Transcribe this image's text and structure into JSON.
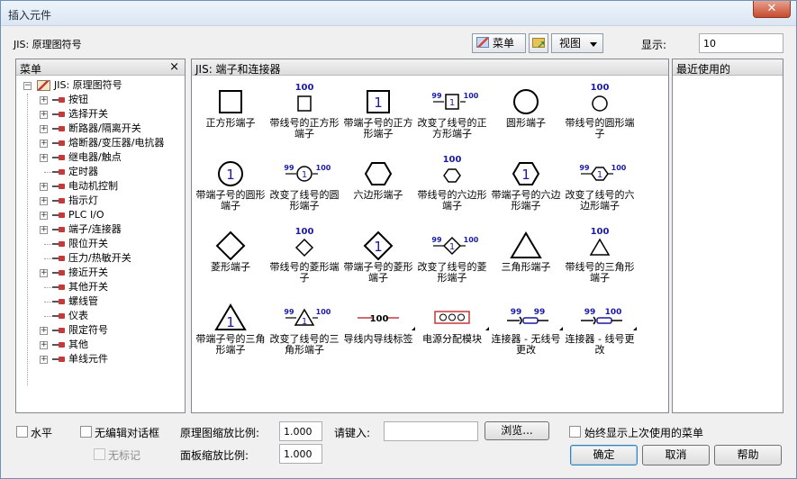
{
  "window": {
    "title": "插入元件"
  },
  "toolbar": {
    "path": "JIS: 原理图符号",
    "menu_btn": "菜单",
    "view_btn": "视图",
    "display_label": "显示:",
    "display_value": "10"
  },
  "left_panel": {
    "title": "菜单",
    "close": "×",
    "root": "JIS: 原理图符号",
    "items": [
      {
        "label": "按钮",
        "expander": "+"
      },
      {
        "label": "选择开关",
        "expander": "+"
      },
      {
        "label": "断路器/隔离开关",
        "expander": "+"
      },
      {
        "label": "熔断器/变压器/电抗器",
        "expander": "+"
      },
      {
        "label": "继电器/触点",
        "expander": "+"
      },
      {
        "label": "定时器",
        "expander": ""
      },
      {
        "label": "电动机控制",
        "expander": "+"
      },
      {
        "label": "指示灯",
        "expander": "+"
      },
      {
        "label": "PLC I/O",
        "expander": "+"
      },
      {
        "label": "端子/连接器",
        "expander": "+"
      },
      {
        "label": "限位开关",
        "expander": ""
      },
      {
        "label": "压力/热敏开关",
        "expander": ""
      },
      {
        "label": "接近开关",
        "expander": "+"
      },
      {
        "label": "其他开关",
        "expander": ""
      },
      {
        "label": "螺线管",
        "expander": ""
      },
      {
        "label": "仪表",
        "expander": ""
      },
      {
        "label": "限定符号",
        "expander": "+"
      },
      {
        "label": "其他",
        "expander": "+"
      },
      {
        "label": "单线元件",
        "expander": "+"
      }
    ]
  },
  "center_panel": {
    "title": "JIS: 端子和连接器",
    "tiles": [
      {
        "label": "正方形端子",
        "icon": "square"
      },
      {
        "label": "带线号的正方形端子",
        "icon": "square-wire",
        "tag": "100"
      },
      {
        "label": "带端子号的正方形端子",
        "icon": "square-num",
        "num": "1"
      },
      {
        "label": "改变了线号的正方形端子",
        "icon": "square-changed",
        "left": "99",
        "right": "100",
        "num": "1"
      },
      {
        "label": "圆形端子",
        "icon": "circle"
      },
      {
        "label": "带线号的圆形端子",
        "icon": "circle-wire",
        "tag": "100"
      },
      {
        "label": "带端子号的圆形端子",
        "icon": "circle-num",
        "num": "1"
      },
      {
        "label": "改变了线号的圆形端子",
        "icon": "circle-changed",
        "left": "99",
        "right": "100",
        "num": "1"
      },
      {
        "label": "六边形端子",
        "icon": "hex"
      },
      {
        "label": "带线号的六边形端子",
        "icon": "hex-wire",
        "tag": "100"
      },
      {
        "label": "带端子号的六边形端子",
        "icon": "hex-num",
        "num": "1"
      },
      {
        "label": "改变了线号的六边形端子",
        "icon": "hex-changed",
        "left": "99",
        "right": "100",
        "num": "1"
      },
      {
        "label": "菱形端子",
        "icon": "diamond"
      },
      {
        "label": "带线号的菱形端子",
        "icon": "diamond-wire",
        "tag": "100"
      },
      {
        "label": "带端子号的菱形端子",
        "icon": "diamond-num",
        "num": "1"
      },
      {
        "label": "改变了线号的菱形端子",
        "icon": "diamond-changed",
        "left": "99",
        "right": "100",
        "num": "1"
      },
      {
        "label": "三角形端子",
        "icon": "triangle"
      },
      {
        "label": "带线号的三角形端子",
        "icon": "triangle-wire",
        "tag": "100"
      },
      {
        "label": "带端子号的三角形端子",
        "icon": "triangle-num",
        "num": "1"
      },
      {
        "label": "改变了线号的三角形端子",
        "icon": "triangle-changed",
        "left": "99",
        "right": "100",
        "num": "1"
      },
      {
        "label": "导线内导线标签",
        "icon": "inline-label",
        "tag": "100"
      },
      {
        "label": "电源分配模块",
        "icon": "power-block"
      },
      {
        "label": "连接器 - 无线号更改",
        "icon": "connector",
        "left": "99",
        "right": "99"
      },
      {
        "label": "连接器 - 线号更改",
        "icon": "connector",
        "left": "99",
        "right": "100"
      }
    ]
  },
  "right_panel": {
    "title": "最近使用的"
  },
  "bottom": {
    "horizontal": "水平",
    "no_edit_dialog": "无编辑对话框",
    "no_tag": "无标记",
    "schematic_scale_label": "原理图缩放比例:",
    "schematic_scale_value": "1.000",
    "panel_scale_label": "面板缩放比例:",
    "panel_scale_value": "1.000",
    "type_label": "请键入:",
    "browse": "浏览...",
    "always_show": "始终显示上次使用的菜单",
    "ok": "确定",
    "cancel": "取消",
    "help": "帮助"
  },
  "colors": {
    "accent_blue": "#1a1aa6",
    "connector_red": "#c23a3a"
  }
}
